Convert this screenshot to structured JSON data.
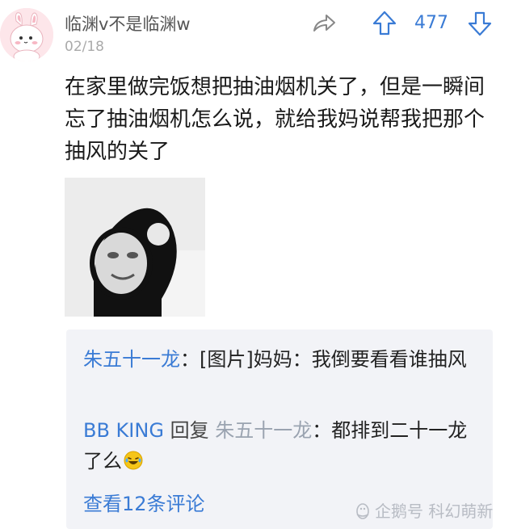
{
  "post": {
    "username": "临渊v不是临渊w",
    "date": "02/18",
    "vote_count": "477",
    "text": "在家里做完饭想把抽油烟机关了，但是一瞬间忘了抽油烟机怎么说，就给我妈说帮我把那个抽风的关了"
  },
  "comments": [
    {
      "author": "朱五十一龙",
      "sep": "：",
      "text": "[图片]妈妈：我倒要看看谁抽风"
    },
    {
      "author": "BB KING",
      "reply_word": " 回复 ",
      "reply_target": "朱五十一龙",
      "sep": "：",
      "text": "都排到二十一龙了么"
    }
  ],
  "view_more": "查看12条评论",
  "watermark": "企鹅号 科幻萌新",
  "colors": {
    "accent": "#3a7bd5",
    "muted": "#aaaaaa",
    "comment_bg": "#f2f3f7"
  },
  "icons": {
    "share": "share-icon",
    "upvote": "upvote-arrow-icon",
    "downvote": "downvote-arrow-icon",
    "laugh": "laughing-emoji-icon"
  }
}
